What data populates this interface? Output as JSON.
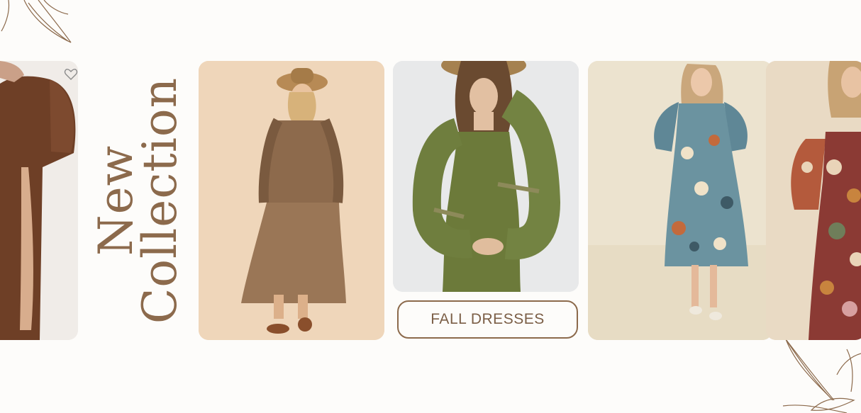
{
  "banner": {
    "heading_line1": "New",
    "heading_line2": "Collection",
    "cta_label": "FALL DRESSES"
  },
  "colors": {
    "background": "#fdfcfa",
    "accent_brown": "#8c6a4c"
  },
  "icons": {
    "favorite": "heart-outline-icon",
    "decoration": "leaf-outline-icon"
  }
}
